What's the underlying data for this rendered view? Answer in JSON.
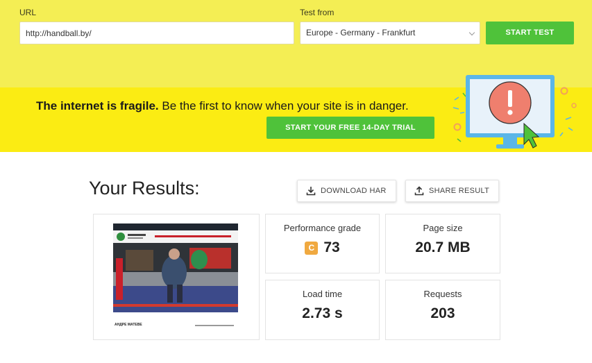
{
  "form": {
    "url_label": "URL",
    "url_value": "http://handball.by/",
    "test_from_label": "Test from",
    "test_from_value": "Europe - Germany - Frankfurt",
    "start_button": "START TEST"
  },
  "banner": {
    "headline_bold": "The internet is fragile.",
    "headline_rest": "Be the first to know when your site is in danger.",
    "trial_button": "START YOUR FREE 14-DAY TRIAL"
  },
  "results": {
    "title": "Your Results:",
    "download_button": "DOWNLOAD HAR",
    "share_button": "SHARE RESULT",
    "screenshot_caption_left": "АНДРЕ МАТЕВЕ",
    "metrics": {
      "performance_grade_label": "Performance grade",
      "performance_grade_letter": "C",
      "performance_grade_value": "73",
      "page_size_label": "Page size",
      "page_size_value": "20.7 MB",
      "load_time_label": "Load time",
      "load_time_value": "2.73 s",
      "requests_label": "Requests",
      "requests_value": "203"
    }
  },
  "colors": {
    "form_band": "#f4ee54",
    "banner": "#fbec13",
    "green_button": "#4fc23a",
    "grade_c": "#f0a940"
  },
  "icons": [
    "chevron-down-icon",
    "monitor-alert-icon",
    "download-icon",
    "share-icon"
  ]
}
